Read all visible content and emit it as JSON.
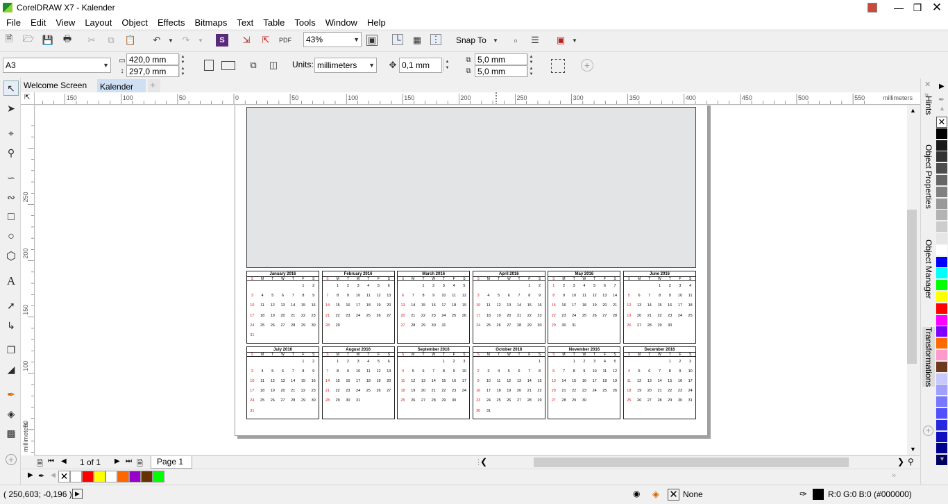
{
  "window": {
    "title": "CorelDRAW X7 - Kalender"
  },
  "menu": [
    "File",
    "Edit",
    "View",
    "Layout",
    "Object",
    "Effects",
    "Bitmaps",
    "Text",
    "Table",
    "Tools",
    "Window",
    "Help"
  ],
  "toolbar": {
    "zoom": "43%",
    "snap_to": "Snap To"
  },
  "propertybar": {
    "paper_size": "A3",
    "width": "420,0 mm",
    "height": "297,0 mm",
    "units_label": "Units:",
    "units_value": "millimeters",
    "nudge": "0,1 mm",
    "dup_x": "5,0 mm",
    "dup_y": "5,0 mm"
  },
  "tabs": [
    "Welcome Screen",
    "Kalender"
  ],
  "ruler": {
    "h_labels": [
      "150",
      "100",
      "50",
      "0",
      "50",
      "100",
      "150",
      "200",
      "250",
      "300",
      "350",
      "400",
      "450",
      "500",
      "550"
    ],
    "h_unit": "millimeters",
    "v_labels": [
      "250",
      "200",
      "150",
      "100",
      "50"
    ],
    "v_unit": "millimeters"
  },
  "calendar": {
    "day_headers": [
      "S",
      "M",
      "T",
      "W",
      "T",
      "F",
      "S"
    ],
    "months": [
      {
        "name": "January 2016",
        "offset": 5,
        "days": 31
      },
      {
        "name": "February 2016",
        "offset": 1,
        "days": 29
      },
      {
        "name": "March 2016",
        "offset": 2,
        "days": 31
      },
      {
        "name": "April 2016",
        "offset": 5,
        "days": 30
      },
      {
        "name": "May 2016",
        "offset": 0,
        "days": 31
      },
      {
        "name": "June 2016",
        "offset": 3,
        "days": 30
      },
      {
        "name": "July 2016",
        "offset": 5,
        "days": 31
      },
      {
        "name": "August 2016",
        "offset": 1,
        "days": 31
      },
      {
        "name": "September 2016",
        "offset": 4,
        "days": 30
      },
      {
        "name": "October 2016",
        "offset": 6,
        "days": 31
      },
      {
        "name": "November 2016",
        "offset": 2,
        "days": 30
      },
      {
        "name": "December 2016",
        "offset": 4,
        "days": 31
      }
    ]
  },
  "dockers": [
    "Hints",
    "Object Properties",
    "Object Manager",
    "Transformations"
  ],
  "pagebar": {
    "page_count": "1 of 1",
    "page_tab": "Page 1"
  },
  "status": {
    "coords": "( 250,603; -0,196 )",
    "fill_label": "None",
    "outline_color": "R:0 G:0 B:0 (#000000)"
  },
  "colors": {
    "palette": [
      "#ffffff",
      "#000000",
      "#1a1a1a",
      "#333333",
      "#4d4d4d",
      "#666666",
      "#808080",
      "#999999",
      "#b3b3b3",
      "#cccccc",
      "#e6e6e6",
      "#ffffff",
      "#0000ff",
      "#00ffff",
      "#00ff00",
      "#ffff00",
      "#ff0000",
      "#ff00ff",
      "#8000ff",
      "#ff6a00",
      "#ff99cc",
      "#6b3a1f",
      "#c8c8ff",
      "#a0a0ff",
      "#7878ff",
      "#5050ff",
      "#2828e0",
      "#1010c0",
      "#000090",
      "#000060"
    ],
    "document_palette": [
      "#ff0000",
      "#ffff00",
      "#ffffff",
      "#ff6600",
      "#9900cc",
      "#663300",
      "#00ff00"
    ]
  }
}
